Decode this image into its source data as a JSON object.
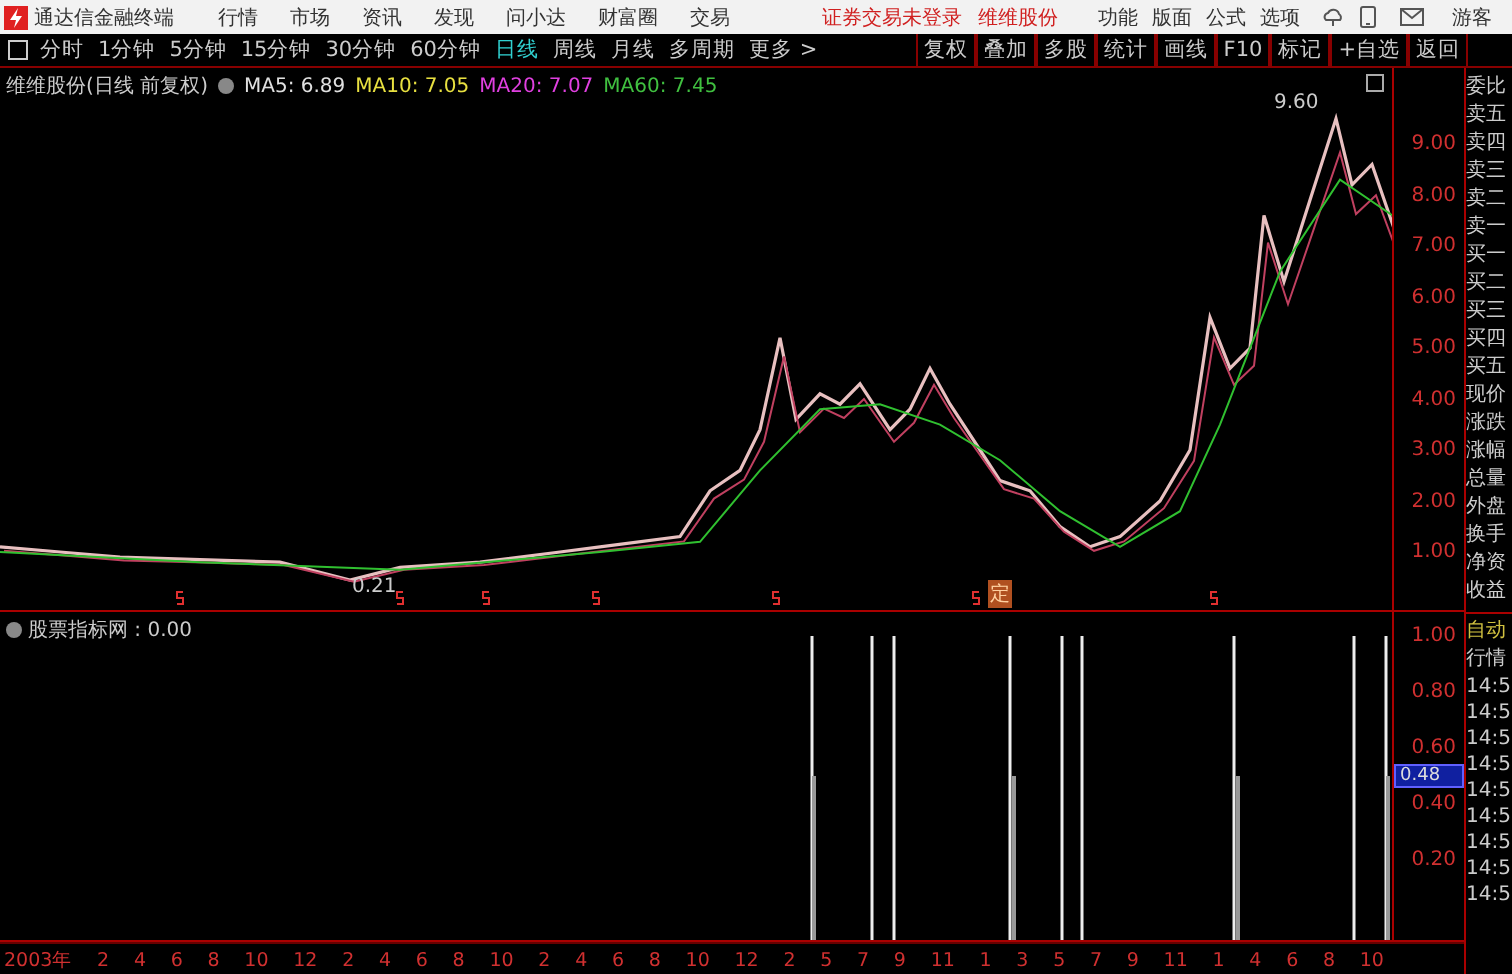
{
  "app": {
    "title": "通达信金融终端",
    "menu": [
      "行情",
      "市场",
      "资讯",
      "发现",
      "问小达",
      "财富圈",
      "交易"
    ],
    "login_status": "证券交易未登录",
    "stock_link": "维维股份",
    "tools": [
      "功能",
      "版面",
      "公式",
      "选项"
    ],
    "user": "游客"
  },
  "periods": [
    {
      "label": "分时",
      "selected": false
    },
    {
      "label": "1分钟",
      "selected": false
    },
    {
      "label": "5分钟",
      "selected": false
    },
    {
      "label": "15分钟",
      "selected": false
    },
    {
      "label": "30分钟",
      "selected": false
    },
    {
      "label": "60分钟",
      "selected": false
    },
    {
      "label": "日线",
      "selected": true
    },
    {
      "label": "周线",
      "selected": false
    },
    {
      "label": "月线",
      "selected": false
    },
    {
      "label": "多周期",
      "selected": false
    },
    {
      "label": "更多 >",
      "selected": false
    }
  ],
  "actions": [
    "复权",
    "叠加",
    "多股",
    "统计",
    "画线",
    "F10",
    "标记",
    "+自选",
    "返回"
  ],
  "main_chart": {
    "legend_title": "维维股份(日线 前复权)",
    "indicators": [
      {
        "text": "MA5: 6.89",
        "color": "#e0e0e0"
      },
      {
        "text": "MA10: 7.05",
        "color": "#e8e040"
      },
      {
        "text": "MA20: 7.07",
        "color": "#e040e0"
      },
      {
        "text": "MA60: 7.45",
        "color": "#40c040"
      }
    ],
    "high_label": "9.60",
    "low_label": "0.21",
    "yticks": [
      "9.00",
      "8.00",
      "7.00",
      "6.00",
      "5.00",
      "4.00",
      "3.00",
      "2.00",
      "1.00"
    ],
    "markers": [
      {
        "kind": "split"
      },
      {
        "kind": "split"
      },
      {
        "kind": "split"
      },
      {
        "kind": "split"
      },
      {
        "kind": "split"
      },
      {
        "kind": "split"
      },
      {
        "kind": "text",
        "text": "定"
      },
      {
        "kind": "split"
      }
    ]
  },
  "indicator_panel": {
    "title": "股票指标网 : 0.00",
    "yticks": [
      "1.00",
      "0.80",
      "0.60",
      "0.40",
      "0.20"
    ],
    "current": "0.48"
  },
  "x_axis": [
    "2003年",
    "2",
    "4",
    "6",
    "8",
    "10",
    "12",
    "2",
    "4",
    "6",
    "8",
    "10",
    "2",
    "4",
    "6",
    "8",
    "10",
    "12",
    "2",
    "5",
    "7",
    "9",
    "11",
    "1",
    "3",
    "5",
    "7",
    "9",
    "11",
    "1",
    "4",
    "6",
    "8",
    "10"
  ],
  "quote_panel": {
    "fields": [
      "委比",
      "卖五",
      "卖四",
      "卖三",
      "卖二",
      "卖一",
      "买一",
      "买二",
      "买三",
      "买四",
      "买五",
      "现价",
      "涨跌",
      "涨幅",
      "总量",
      "外盘",
      "换手",
      "净资",
      "收益"
    ],
    "mode": "自动",
    "label": "行情",
    "times": [
      "14:5",
      "14:5",
      "14:5",
      "14:5",
      "14:5",
      "14:5",
      "14:5",
      "14:5",
      "14:5"
    ]
  }
}
